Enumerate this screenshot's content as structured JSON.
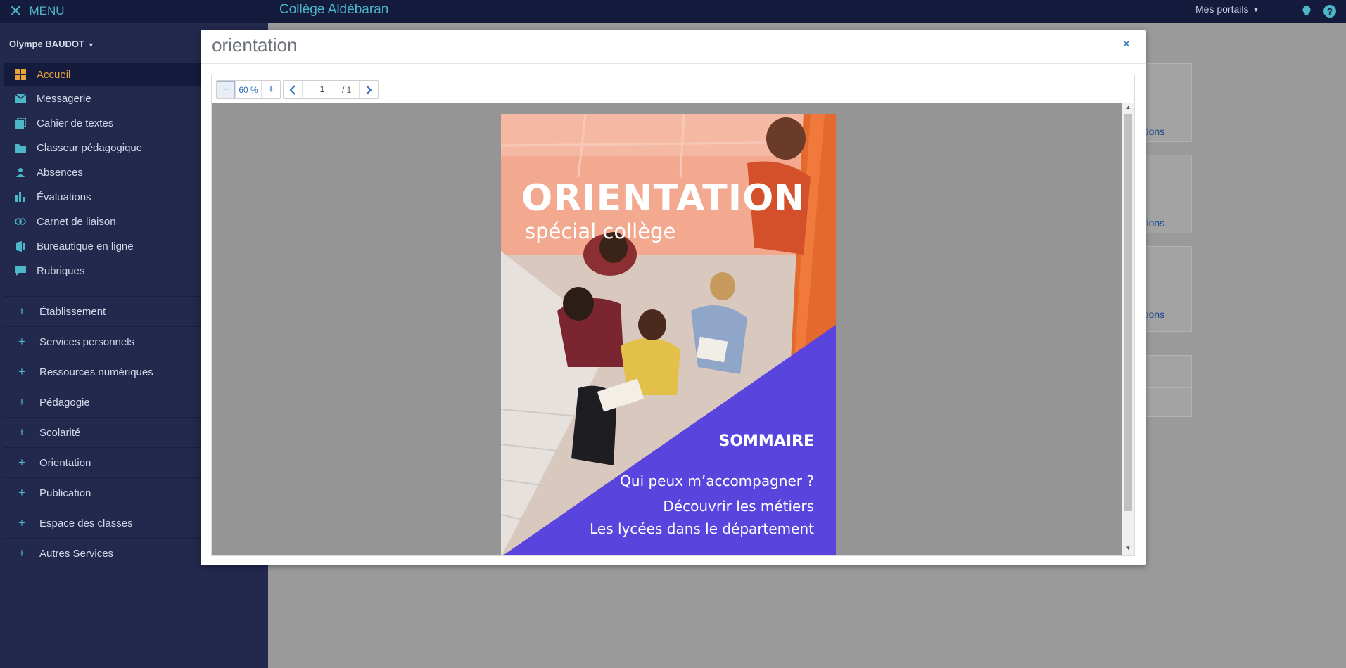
{
  "topbar": {
    "menu_label": "MENU",
    "site_name": "Collège Aldébaran",
    "portals_label": "Mes portails"
  },
  "sidebar": {
    "user_name": "Olympe BAUDOT",
    "items": [
      {
        "label": "Accueil",
        "icon": "dashboard-icon",
        "active": true
      },
      {
        "label": "Messagerie",
        "icon": "envelope-icon"
      },
      {
        "label": "Cahier de textes",
        "icon": "notebook-icon"
      },
      {
        "label": "Classeur pédagogique",
        "icon": "folder-icon"
      },
      {
        "label": "Absences",
        "icon": "person-icon"
      },
      {
        "label": "Évaluations",
        "icon": "bar-chart-icon"
      },
      {
        "label": "Carnet de liaison",
        "icon": "link-icon"
      },
      {
        "label": "Bureautique en ligne",
        "icon": "office-icon"
      },
      {
        "label": "Rubriques",
        "icon": "comment-icon"
      }
    ],
    "sections": [
      "Établissement",
      "Services personnels",
      "Ressources numériques",
      "Pédagogie",
      "Scolarité",
      "Orientation",
      "Publication",
      "Espace des classes",
      "Autres Services"
    ]
  },
  "background": {
    "links": [
      "nations",
      "nations",
      "nations"
    ]
  },
  "modal": {
    "title": "orientation",
    "close_symbol": "×",
    "toolbar": {
      "zoom_out": "−",
      "zoom_level": "60 %",
      "zoom_in": "+",
      "prev": "‹",
      "page_current": "1",
      "page_total": "/ 1",
      "next": "›"
    },
    "document": {
      "title": "ORIENTATION",
      "subtitle": "spécial collège",
      "toc_heading": "SOMMAIRE",
      "toc": [
        "Qui peux m’accompagner ?",
        "Découvrir les métiers",
        "Les lycées dans le département"
      ]
    }
  },
  "colors": {
    "topbar_bg": "#141b3c",
    "sidebar_bg": "#23284d",
    "accent_teal": "#4db6c9",
    "active_orange": "#e9a23b",
    "pdf_purple": "#5a44de",
    "pdf_salmon": "#f2a98f"
  }
}
